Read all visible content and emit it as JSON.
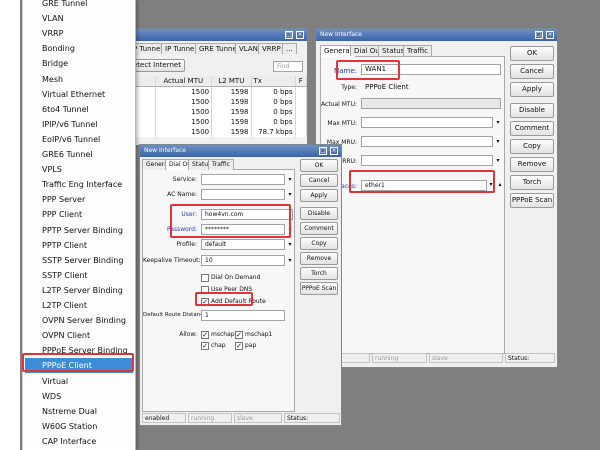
{
  "menu": {
    "items": [
      "GRE Tunnel",
      "VLAN",
      "VRRP",
      "Bonding",
      "Bridge",
      "Mesh",
      "Virtual Ethernet",
      "6to4 Tunnel",
      "IPIP/v6 Tunnel",
      "EoIP/v6 Tunnel",
      "GRE6 Tunnel",
      "VPLS",
      "Traffic Eng Interface",
      "PPP Server",
      "PPP Client",
      "PPTP Server Binding",
      "PPTP Client",
      "SSTP Server Binding",
      "SSTP Client",
      "L2TP Server Binding",
      "L2TP Client",
      "OVPN Server Binding",
      "OVPN Client",
      "PPPoE Server Binding",
      "PPPoE Client",
      "Virtual",
      "WDS",
      "Nstreme Dual",
      "W60G Station",
      "CAP Interface"
    ],
    "selected": "PPPoE Client"
  },
  "list_window": {
    "tabs": [
      "P Tunnel",
      "IP Tunnel",
      "GRE Tunnel",
      "VLAN",
      "VRRP",
      "..."
    ],
    "detect_btn": "etect Internet",
    "find_placeholder": "Find",
    "columns": [
      "Actual MTU",
      "L2 MTU",
      "Tx",
      "F"
    ],
    "rows": [
      [
        "1500",
        "1598",
        "0 bps"
      ],
      [
        "1500",
        "1598",
        "0 bps"
      ],
      [
        "1500",
        "1598",
        "0 bps"
      ],
      [
        "1500",
        "1598",
        "0 bps"
      ],
      [
        "1500",
        "1598",
        "78.7 kbps"
      ]
    ]
  },
  "right_window": {
    "title": "New Interface",
    "tabs": [
      "General",
      "Dial Out",
      "Status",
      "Traffic"
    ],
    "labels": {
      "name": "Name:",
      "type": "Type:",
      "actual_mtu": "Actual MTU:",
      "max_mtu": "Max MTU:",
      "max_mru": "Max MRU:",
      "mrru": "RRU:",
      "interfaces": "aces:"
    },
    "name_value": "WAN1",
    "type_value": "PPPoE Client",
    "interface_value": "ether1",
    "buttons": [
      "OK",
      "Cancel",
      "Apply",
      "Disable",
      "Comment",
      "Copy",
      "Remove",
      "Torch",
      "PPPoE Scan"
    ],
    "status": {
      "running": "running",
      "slave": "slave",
      "label": "Status:"
    }
  },
  "front_window": {
    "title": "New Interface",
    "tabs": [
      "General",
      "Dial Out",
      "Status",
      "Traffic"
    ],
    "labels": {
      "service": "Service:",
      "ac_name": "AC Name:",
      "user": "User:",
      "password": "Password:",
      "profile": "Profile:",
      "keepalive": "Keepalive Timeout:",
      "route_distance": "Default Route Distance:",
      "allow": "Allow:"
    },
    "user_value": "how4vn.com",
    "password_value": "********",
    "profile_value": "default",
    "keepalive_value": "10",
    "route_distance_value": "1",
    "checkboxes": {
      "dial_on_demand": "Dial On Demand",
      "use_peer_dns": "Use Peer DNS",
      "add_default_route": "Add Default Route"
    },
    "allow": {
      "mschap2": "mschap2",
      "mschap1": "mschap1",
      "chap": "chap",
      "pap": "pap"
    },
    "buttons": [
      "OK",
      "Cancel",
      "Apply",
      "Disable",
      "Comment",
      "Copy",
      "Remove",
      "Torch",
      "PPPoE Scan"
    ],
    "status": {
      "enabled": "enabled",
      "running": "running",
      "slave": "slave",
      "label": "Status:"
    }
  },
  "colors": {
    "highlight": "#e0343b",
    "selection": "#3c8cd8",
    "titlebar": "#3c64a5"
  }
}
